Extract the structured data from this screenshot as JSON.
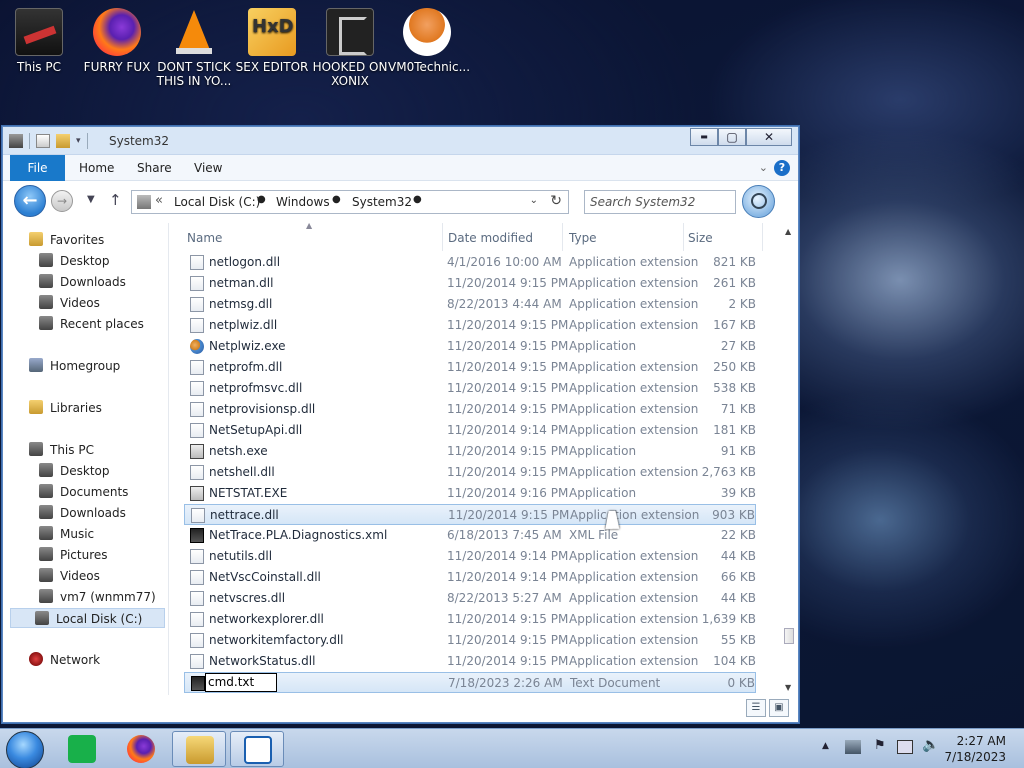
{
  "desktop": {
    "icons": [
      {
        "label": "This PC"
      },
      {
        "label": "FURRY FUX"
      },
      {
        "label": "DONT STICK THIS IN YO..."
      },
      {
        "label": "SEX EDITOR"
      },
      {
        "label": "HOOKED ON XONIX"
      },
      {
        "label": "VM0Technic..."
      }
    ],
    "hxd_logo_text": "HxD"
  },
  "window": {
    "title": "System32",
    "controls": {
      "minimize": "▬",
      "maximize": "▢",
      "close": "✕"
    },
    "ribbon": {
      "tabs": [
        "File",
        "Home",
        "Share",
        "View"
      ],
      "help": "?"
    },
    "nav": {
      "back": "←",
      "forward": "→",
      "address_prefix": "«",
      "breadcrumbs": [
        "Local Disk (C:)",
        "Windows",
        "System32"
      ],
      "search_placeholder": "Search System32"
    },
    "navpane": {
      "favorites": {
        "label": "Favorites",
        "items": [
          "Desktop",
          "Downloads",
          "Videos",
          "Recent places"
        ]
      },
      "homegroup": "Homegroup",
      "libraries": "Libraries",
      "thispc": {
        "label": "This PC",
        "items": [
          "Desktop",
          "Documents",
          "Downloads",
          "Music",
          "Pictures",
          "Videos",
          "vm7 (wnmm77)",
          "Local Disk (C:)"
        ]
      },
      "network": "Network"
    },
    "columns": {
      "name": "Name",
      "date": "Date modified",
      "type": "Type",
      "size": "Size"
    },
    "files": [
      {
        "name": "netlogon.dll",
        "date": "4/1/2016 10:00 AM",
        "type": "Application extension",
        "size": "821 KB",
        "icon": "dll"
      },
      {
        "name": "netman.dll",
        "date": "11/20/2014 9:15 PM",
        "type": "Application extension",
        "size": "261 KB",
        "icon": "dll"
      },
      {
        "name": "netmsg.dll",
        "date": "8/22/2013 4:44 AM",
        "type": "Application extension",
        "size": "2 KB",
        "icon": "dll"
      },
      {
        "name": "netplwiz.dll",
        "date": "11/20/2014 9:15 PM",
        "type": "Application extension",
        "size": "167 KB",
        "icon": "dll"
      },
      {
        "name": "Netplwiz.exe",
        "date": "11/20/2014 9:15 PM",
        "type": "Application",
        "size": "27 KB",
        "icon": "people"
      },
      {
        "name": "netprofm.dll",
        "date": "11/20/2014 9:15 PM",
        "type": "Application extension",
        "size": "250 KB",
        "icon": "dll"
      },
      {
        "name": "netprofmsvc.dll",
        "date": "11/20/2014 9:15 PM",
        "type": "Application extension",
        "size": "538 KB",
        "icon": "dll"
      },
      {
        "name": "netprovisionsp.dll",
        "date": "11/20/2014 9:15 PM",
        "type": "Application extension",
        "size": "71 KB",
        "icon": "dll"
      },
      {
        "name": "NetSetupApi.dll",
        "date": "11/20/2014 9:14 PM",
        "type": "Application extension",
        "size": "181 KB",
        "icon": "dll"
      },
      {
        "name": "netsh.exe",
        "date": "11/20/2014 9:15 PM",
        "type": "Application",
        "size": "91 KB",
        "icon": "exe2"
      },
      {
        "name": "netshell.dll",
        "date": "11/20/2014 9:15 PM",
        "type": "Application extension",
        "size": "2,763 KB",
        "icon": "dll"
      },
      {
        "name": "NETSTAT.EXE",
        "date": "11/20/2014 9:16 PM",
        "type": "Application",
        "size": "39 KB",
        "icon": "exe2"
      },
      {
        "name": "nettrace.dll",
        "date": "11/20/2014 9:15 PM",
        "type": "Application extension",
        "size": "903 KB",
        "icon": "dll",
        "selected": true
      },
      {
        "name": "NetTrace.PLA.Diagnostics.xml",
        "date": "6/18/2013 7:45 AM",
        "type": "XML File",
        "size": "22 KB",
        "icon": "txt"
      },
      {
        "name": "netutils.dll",
        "date": "11/20/2014 9:14 PM",
        "type": "Application extension",
        "size": "44 KB",
        "icon": "dll"
      },
      {
        "name": "NetVscCoinstall.dll",
        "date": "11/20/2014 9:14 PM",
        "type": "Application extension",
        "size": "66 KB",
        "icon": "dll"
      },
      {
        "name": "netvscres.dll",
        "date": "8/22/2013 5:27 AM",
        "type": "Application extension",
        "size": "44 KB",
        "icon": "dll"
      },
      {
        "name": "networkexplorer.dll",
        "date": "11/20/2014 9:15 PM",
        "type": "Application extension",
        "size": "1,639 KB",
        "icon": "dll"
      },
      {
        "name": "networkitemfactory.dll",
        "date": "11/20/2014 9:15 PM",
        "type": "Application extension",
        "size": "55 KB",
        "icon": "dll"
      },
      {
        "name": "NetworkStatus.dll",
        "date": "11/20/2014 9:15 PM",
        "type": "Application extension",
        "size": "104 KB",
        "icon": "dll"
      },
      {
        "name": "cmd.txt",
        "date": "7/18/2023 2:26 AM",
        "type": "Text Document",
        "size": "0 KB",
        "icon": "txt",
        "renaming": true
      }
    ]
  },
  "taskbar": {
    "clock_time": "2:27 AM",
    "clock_date": "7/18/2023"
  }
}
